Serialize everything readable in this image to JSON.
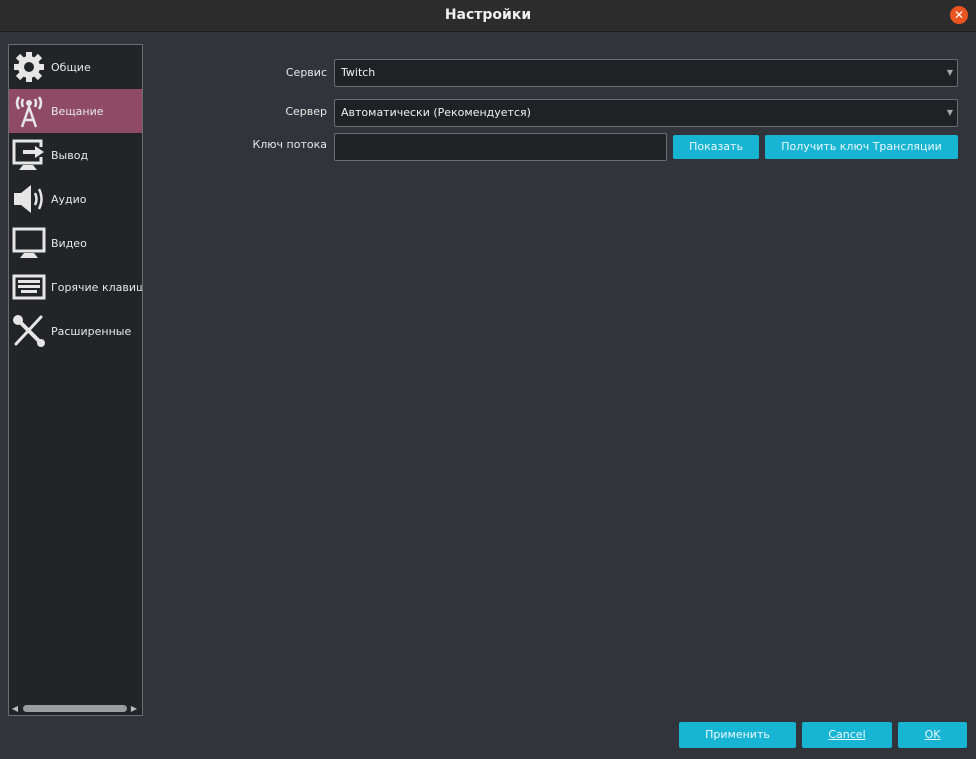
{
  "window": {
    "title": "Настройки",
    "close_icon": "close-icon"
  },
  "sidebar": {
    "items": [
      {
        "label": "Общие",
        "icon": "gear-icon"
      },
      {
        "label": "Вещание",
        "icon": "broadcast-tower-icon",
        "selected": true
      },
      {
        "label": "Вывод",
        "icon": "output-monitor-icon"
      },
      {
        "label": "Аудио",
        "icon": "speaker-icon"
      },
      {
        "label": "Видео",
        "icon": "monitor-icon"
      },
      {
        "label": "Горячие клавиши",
        "icon": "keyboard-icon"
      },
      {
        "label": "Расширенные",
        "icon": "tools-icon"
      }
    ]
  },
  "form": {
    "service_label": "Сервис",
    "service_value": "Twitch",
    "server_label": "Сервер",
    "server_value": "Автоматически (Рекомендуется)",
    "key_label": "Ключ потока",
    "key_value": "",
    "show_button": "Показать",
    "get_key_button": "Получить ключ Трансляции"
  },
  "footer": {
    "apply": "Применить",
    "cancel": "Cancel",
    "ok": "OK"
  },
  "colors": {
    "accent": "#17b5d3",
    "selected": "#8f4a65",
    "close": "#e95420"
  }
}
